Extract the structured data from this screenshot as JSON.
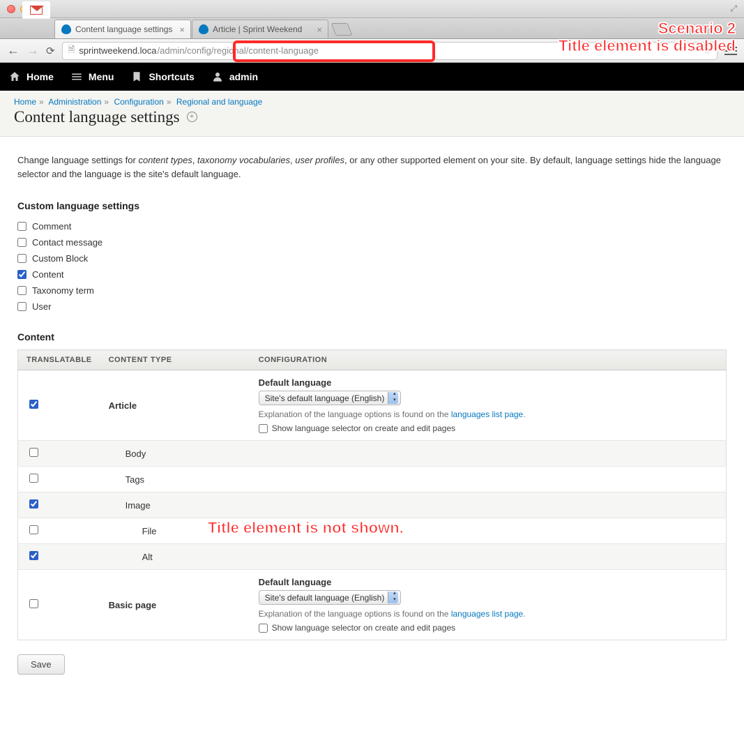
{
  "browser": {
    "tabs": [
      {
        "title": "Content language settings"
      },
      {
        "title": "Article | Sprint Weekend"
      }
    ],
    "url_host": "sprintweekend.loca",
    "url_path": "/admin/config/regional/content-language"
  },
  "toolbar": {
    "home": "Home",
    "menu": "Menu",
    "shortcuts": "Shortcuts",
    "admin": "admin"
  },
  "breadcrumb": {
    "home": "Home",
    "admin": "Administration",
    "config": "Configuration",
    "regional": "Regional and language"
  },
  "page_title": "Content language settings",
  "intro": {
    "lead": "Change language settings for ",
    "em1": "content types",
    "sep1": ", ",
    "em2": "taxonomy vocabularies",
    "sep2": ", ",
    "em3": "user profiles",
    "tail": ", or any other supported element on your site. By default, language settings hide the language selector and the language is the site's default language."
  },
  "custom_heading": "Custom language settings",
  "entity_types": [
    {
      "label": "Comment",
      "checked": false
    },
    {
      "label": "Contact message",
      "checked": false
    },
    {
      "label": "Custom Block",
      "checked": false
    },
    {
      "label": "Content",
      "checked": true
    },
    {
      "label": "Taxonomy term",
      "checked": false
    },
    {
      "label": "User",
      "checked": false
    }
  ],
  "content_heading": "Content",
  "table_headers": {
    "translatable": "Translatable",
    "content_type": "Content Type",
    "configuration": "Configuration"
  },
  "content_rows": {
    "article": {
      "label": "Article",
      "checked": true,
      "cfg": {
        "default_lang_label": "Default language",
        "select_value": "Site's default language (English)",
        "hint_pre": "Explanation of the language options is found on the ",
        "hint_link": "languages list page",
        "hint_post": ".",
        "show_selector_label": "Show language selector on create and edit pages",
        "show_selector_checked": false
      },
      "fields": [
        {
          "label": "Body",
          "checked": false,
          "indent": 1
        },
        {
          "label": "Tags",
          "checked": false,
          "indent": 1
        },
        {
          "label": "Image",
          "checked": true,
          "indent": 1
        },
        {
          "label": "File",
          "checked": false,
          "indent": 2
        },
        {
          "label": "Alt",
          "checked": true,
          "indent": 2
        }
      ]
    },
    "basic_page": {
      "label": "Basic page",
      "checked": false,
      "cfg": {
        "default_lang_label": "Default language",
        "select_value": "Site's default language (English)",
        "hint_pre": "Explanation of the language options is found on the ",
        "hint_link": "languages list page",
        "hint_post": ".",
        "show_selector_label": "Show language selector on create and edit pages",
        "show_selector_checked": false
      }
    }
  },
  "save_label": "Save",
  "annotations": {
    "top1": "Scenario 2",
    "top2": "Title element is disabled",
    "mid": "Title element is not shown."
  }
}
